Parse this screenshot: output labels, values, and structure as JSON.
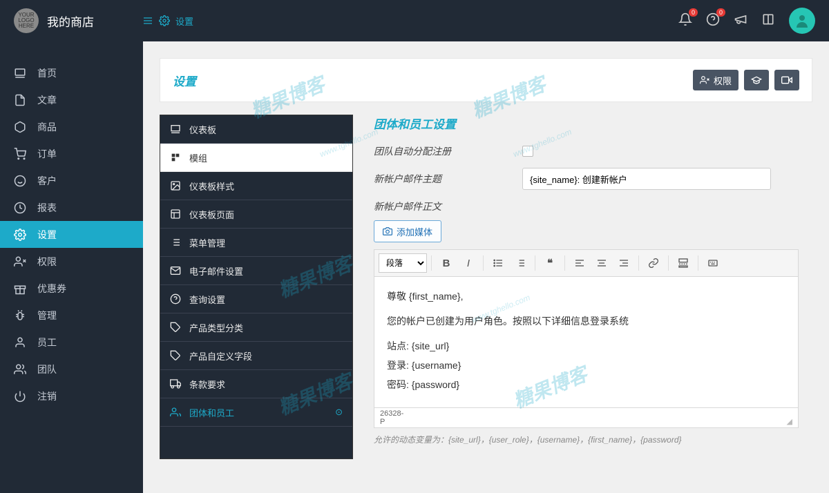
{
  "brand": "我的商店",
  "logo_text": "YOUR LOGO HERE",
  "top_toggle_label": "设置",
  "top_icons": {
    "bell_badge": "0",
    "help_badge": "0"
  },
  "sidebar": [
    {
      "label": "首页"
    },
    {
      "label": "文章"
    },
    {
      "label": "商品"
    },
    {
      "label": "订单"
    },
    {
      "label": "客户"
    },
    {
      "label": "报表"
    },
    {
      "label": "设置"
    },
    {
      "label": "权限"
    },
    {
      "label": "优惠券"
    },
    {
      "label": "管理"
    },
    {
      "label": "员工"
    },
    {
      "label": "团队"
    },
    {
      "label": "注销"
    }
  ],
  "page_title": "设置",
  "header_buttons": {
    "permissions": "权限"
  },
  "settings_nav": [
    {
      "label": "仪表板"
    },
    {
      "label": "模组"
    },
    {
      "label": "仪表板样式"
    },
    {
      "label": "仪表板页面"
    },
    {
      "label": "菜单管理"
    },
    {
      "label": "电子邮件设置"
    },
    {
      "label": "查询设置"
    },
    {
      "label": "产品类型分类"
    },
    {
      "label": "产品自定义字段"
    },
    {
      "label": "条款要求"
    },
    {
      "label": "团体和员工"
    }
  ],
  "form": {
    "section_title": "团体和员工设置",
    "auto_assign_label": "团队自动分配注册",
    "subject_label": "新帐户邮件主题",
    "subject_value": "{site_name}: 创建新帐户",
    "body_label": "新帐户邮件正文",
    "add_media": "添加媒体",
    "paragraph_option": "段落",
    "hint": "允许的动态变量为：{site_url}，{user_role}，{username}，{first_name}，{password}",
    "status_left": "26328-",
    "status_p": "P"
  },
  "editor_content": {
    "line1": "尊敬 {first_name},",
    "line2": "您的帐户已创建为用户角色。按照以下详细信息登录系统",
    "line3": "站点: {site_url}",
    "line4": "登录: {username}",
    "line5": "密码: {password}"
  },
  "watermark": "糖果博客",
  "watermark_url": "www.tghello.com"
}
